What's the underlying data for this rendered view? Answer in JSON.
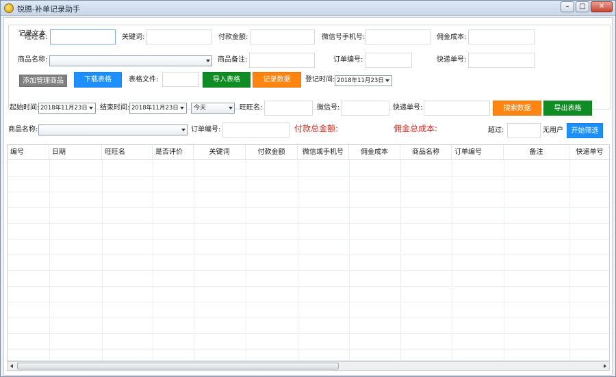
{
  "window": {
    "title": "锐腾-补单记录助手",
    "minimize": "–",
    "maximize": "□",
    "close": "✕"
  },
  "group": {
    "title": "记录文本"
  },
  "form": {
    "wangwang_label": "旺旺名:",
    "keyword_label": "关键词:",
    "pay_amount_label": "付款金额:",
    "wechat_label": "微信号手机号:",
    "commission_label": "佣金成本:",
    "product_name_label": "商品名称:",
    "product_note_label": "商品备注:",
    "order_no_label": "订单编号:",
    "express_no_label": "快递单号:",
    "table_file_label": "表格文件:",
    "login_time_label": "登记时间:",
    "login_time_value": "2018年11月23日"
  },
  "buttons": {
    "add_product": "添加管理商品",
    "download_table": "下载表格",
    "import_table": "导入表格",
    "record_data": "记录数据",
    "search_data": "搜索数据",
    "export_table": "导出表格",
    "start_filter": "开始筛选"
  },
  "search": {
    "start_time_label": "起始时间:",
    "start_time_value": "2018年11月23日",
    "end_time_label": "结束时间:",
    "end_time_value": "2018年11月23日",
    "period_value": "今天",
    "wangwang_label": "旺旺名:",
    "wechat_label": "微信号:",
    "express_label": "快递单号:",
    "product_name_label": "商品名称:",
    "order_no_label": "订单编号:",
    "total_pay_label": "付款总金额:",
    "total_commission_label": "佣金总成本:",
    "exceed_label": "超过:",
    "no_user_label": "无用户"
  },
  "table": {
    "columns": [
      "编号",
      "日期",
      "旺旺名",
      "是否评价",
      "关键词",
      "付款金额",
      "微信或手机号",
      "佣金成本",
      "商品名称",
      "订单编号",
      "备注",
      "快递单号"
    ]
  },
  "scrollbar": {
    "grip": "|||"
  }
}
